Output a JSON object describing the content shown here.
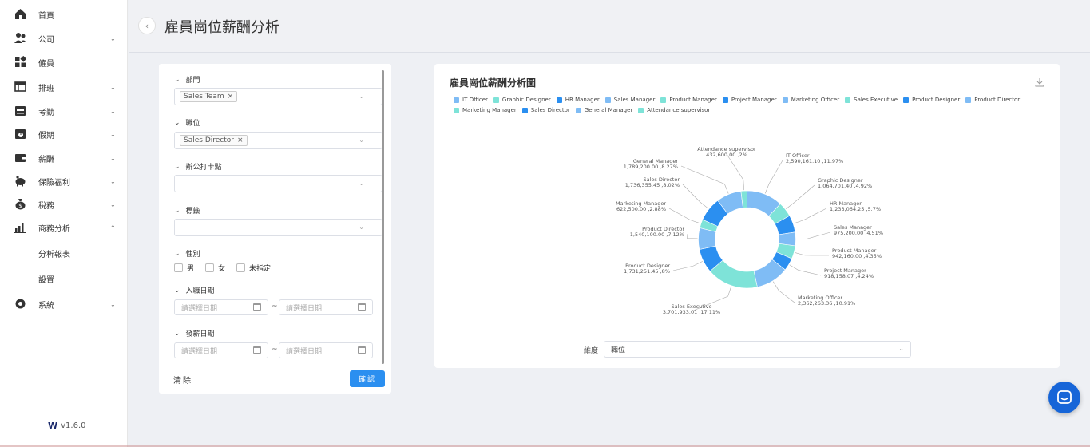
{
  "sidebar": {
    "items": [
      {
        "label": "首頁",
        "icon": "home-icon",
        "chevron": ""
      },
      {
        "label": "公司",
        "icon": "users-icon",
        "chevron": "⌄"
      },
      {
        "label": "僱員",
        "icon": "grid-icon",
        "chevron": ""
      },
      {
        "label": "排班",
        "icon": "table-icon",
        "chevron": "⌄"
      },
      {
        "label": "考勤",
        "icon": "calendar-icon",
        "chevron": "⌄"
      },
      {
        "label": "假期",
        "icon": "leave-icon",
        "chevron": "⌄"
      },
      {
        "label": "薪酬",
        "icon": "wallet-icon",
        "chevron": "⌄"
      },
      {
        "label": "保險福利",
        "icon": "piggy-bank-icon",
        "chevron": "⌄"
      },
      {
        "label": "稅務",
        "icon": "money-bag-icon",
        "chevron": "⌄"
      },
      {
        "label": "商務分析",
        "icon": "bar-chart-icon",
        "chevron": "⌃"
      },
      {
        "label": "分析報表",
        "icon": "",
        "chevron": ""
      },
      {
        "label": "設置",
        "icon": "",
        "chevron": ""
      },
      {
        "label": "系統",
        "icon": "gear-icon",
        "chevron": "⌄"
      }
    ],
    "version": "v1.6.0"
  },
  "header": {
    "title": "雇員崗位薪酬分析"
  },
  "filter": {
    "department_label": "部門",
    "department_tag": "Sales Team",
    "position_label": "職位",
    "position_tag": "Sales Director",
    "office_label": "辦公打卡點",
    "tags_label": "標籤",
    "gender_label": "性別",
    "gender_options": [
      "男",
      "女",
      "未指定"
    ],
    "join_date_label": "入職日期",
    "pay_date_label": "發薪日期",
    "date_placeholder": "請選擇日期",
    "tilde": "~",
    "clear_label": "清除",
    "confirm_label": "確認"
  },
  "card": {
    "title": "雇員崗位薪酬分析圖",
    "dimension_label": "維度",
    "dimension_value": "職位"
  },
  "colors": {
    "c1": "#7fbcf5",
    "c2": "#7ee3d8",
    "c3": "#2b8ff0",
    "primary": "#2b8ff0",
    "chat": "#1665d8"
  },
  "chart_data": {
    "type": "pie",
    "title": "雇員崗位薪酬分析圖",
    "donut": true,
    "legend_position": "top-left",
    "slices": [
      {
        "name": "IT Officer",
        "value": 2590161.1,
        "label": "2,590,161.10 ,11.97%",
        "color": "#7fbcf5"
      },
      {
        "name": "Graphic Designer",
        "value": 1064701.4,
        "label": "1,064,701.40 ,4.92%",
        "color": "#7ee3d8"
      },
      {
        "name": "HR Manager",
        "value": 1233064.25,
        "label": "1,233,064.25 ,5.7%",
        "color": "#2b8ff0"
      },
      {
        "name": "Sales Manager",
        "value": 975200.0,
        "label": "975,200.00 ,4.51%",
        "color": "#7fbcf5"
      },
      {
        "name": "Product Manager",
        "value": 942160.0,
        "label": "942,160.00 ,4.35%",
        "color": "#7ee3d8"
      },
      {
        "name": "Project Manager",
        "value": 918158.07,
        "label": "918,158.07 ,4.24%",
        "color": "#2b8ff0"
      },
      {
        "name": "Marketing Officer",
        "value": 2362263.36,
        "label": "2,362,263.36 ,10.91%",
        "color": "#7fbcf5"
      },
      {
        "name": "Sales Executive",
        "value": 3701933.01,
        "label": "3,701,933.01 ,17.11%",
        "color": "#7ee3d8"
      },
      {
        "name": "Product Designer",
        "value": 1731251.45,
        "label": "1,731,251.45 ,8%",
        "color": "#2b8ff0"
      },
      {
        "name": "Product Director",
        "value": 1540100.0,
        "label": "1,540,100.00 ,7.12%",
        "color": "#7fbcf5"
      },
      {
        "name": "Marketing Manager",
        "value": 622500.0,
        "label": "622,500.00 ,2.88%",
        "color": "#7ee3d8"
      },
      {
        "name": "Sales Director",
        "value": 1736355.45,
        "label": "1,736,355.45 ,8.02%",
        "color": "#2b8ff0"
      },
      {
        "name": "General Manager",
        "value": 1789200.0,
        "label": "1,789,200.00 ,8.27%",
        "color": "#7fbcf5"
      },
      {
        "name": "Attendance supervisor",
        "value": 432600.0,
        "label": "432,600.00 ,2%",
        "color": "#7ee3d8"
      }
    ]
  }
}
